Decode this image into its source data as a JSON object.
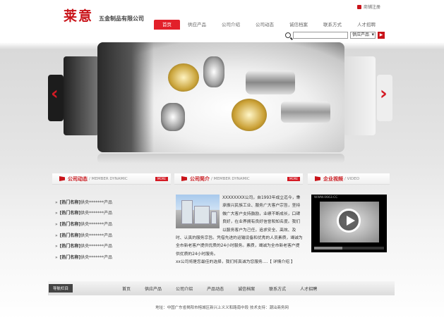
{
  "header": {
    "logo": "莱意",
    "company": "五金制品有限公司",
    "favorite_link": "商铺注册"
  },
  "nav": {
    "items": [
      "首页",
      "供应产品",
      "公司介绍",
      "公司动态",
      "诚信档案",
      "联系方式",
      "人才招聘"
    ],
    "active_index": 0
  },
  "search": {
    "placeholder": "",
    "select_value": "供应产品",
    "go_label": "▶"
  },
  "banner": {
    "prev_arrow": "‹",
    "next_arrow": "›"
  },
  "sections": {
    "news": {
      "title": "公司动态",
      "subtitle": "/ MEMBER DYNAMIC",
      "more": "MORE"
    },
    "about": {
      "title": "公司简介",
      "subtitle": "/ MEMBER DYNAMIC",
      "more": "MORE"
    },
    "video": {
      "title": "企业视频",
      "subtitle": "/ VIDEO"
    }
  },
  "news_items": [
    {
      "arrow": "»",
      "cat": "[热门名称]",
      "text": "供央*******产品"
    },
    {
      "arrow": "»",
      "cat": "[热门名称]",
      "text": "供央*******产品"
    },
    {
      "arrow": "»",
      "cat": "[热门名称]",
      "text": "供央*******产品"
    },
    {
      "arrow": "»",
      "cat": "[热门名称]",
      "text": "供央*******产品"
    },
    {
      "arrow": "»",
      "cat": "[热门名称]",
      "text": "供央*******产品"
    },
    {
      "arrow": "»",
      "cat": "[热门名称]",
      "text": "供央*******产品"
    }
  ],
  "about": {
    "text": "XXXXXXXX公司，自1993年成立迄今，秉承振兴民族工业、服务广大客户宗旨，坚持做广大客户支持鼓励，业绩不断成长，口碑良好，在业界拥有良好信誉和知名度。我们以服务客户为己任，追求安全、高效、及时、认真的服务宗旨。凭借先进的运输设备和优秀的人员素质，竭诚为全市新老客户提供优质的24小时服务。素质，竭诚为全市新老客户提供优质的24小时服务。",
    "closing": "xx公司将是您最佳的选择，我们将真诚为您服务....【 详情介绍 】"
  },
  "video": {
    "site": "WWW.0663.CC"
  },
  "footer": {
    "nav_label": "导航栏目",
    "links": [
      "首页",
      "供应产品",
      "公司介绍",
      "产品动态",
      "诚信档案",
      "联系方式",
      "人才招聘"
    ],
    "copyright": "地址：中国广东省揭阳市榕城区新兴上义义和路南中段  技术支持：潮汕商务网"
  },
  "colors": {
    "brand_red": "#c9141a",
    "nav_active": "#e2202a"
  }
}
